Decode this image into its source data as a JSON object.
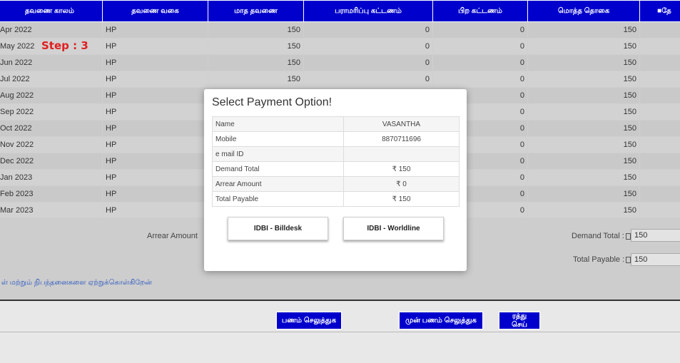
{
  "columns": [
    "தவணை காலம்",
    "தவணை வகை",
    "மாத தவணை",
    "பராமரிப்பு கட்டணம்",
    "பிற கட்டணம்",
    "மொத்த தொகை",
    "■தே"
  ],
  "rows": [
    [
      "Apr 2022",
      "HP",
      "150",
      "0",
      "0",
      "150"
    ],
    [
      "May 2022",
      "HP",
      "150",
      "0",
      "0",
      "150"
    ],
    [
      "Jun 2022",
      "HP",
      "150",
      "0",
      "0",
      "150"
    ],
    [
      "Jul 2022",
      "HP",
      "150",
      "0",
      "0",
      "150"
    ],
    [
      "Aug 2022",
      "HP",
      "",
      "",
      "0",
      "150"
    ],
    [
      "Sep 2022",
      "HP",
      "",
      "",
      "0",
      "150"
    ],
    [
      "Oct 2022",
      "HP",
      "",
      "",
      "0",
      "150"
    ],
    [
      "Nov 2022",
      "HP",
      "",
      "",
      "0",
      "150"
    ],
    [
      "Dec 2022",
      "HP",
      "",
      "",
      "0",
      "150"
    ],
    [
      "Jan 2023",
      "HP",
      "",
      "",
      "0",
      "150"
    ],
    [
      "Feb 2023",
      "HP",
      "",
      "",
      "0",
      "150"
    ],
    [
      "Mar 2023",
      "HP",
      "",
      "",
      "0",
      "150"
    ]
  ],
  "step_label": "Step : 3",
  "summary": {
    "arrear_label": "Arrear Amount",
    "demand_label": "Demand Total :",
    "demand_value": "150",
    "payable_label": "Total Payable :",
    "payable_value": "150"
  },
  "terms_text": "ள் மற்றும் நிபந்தனைகளை ஏற்றுக்கொள்கிறேன்",
  "buttons": {
    "pay": "பணம் செலுத்துக",
    "advance_pay": "முன் பணம் செலுத்துக",
    "cancel": "ரத்து செய்"
  },
  "modal": {
    "title": "Select Payment Option!",
    "fields": [
      {
        "label": "Name",
        "value": "VASANTHA"
      },
      {
        "label": "Mobile",
        "value": "8870711696"
      },
      {
        "label": "e mail ID",
        "value": ""
      },
      {
        "label": "Demand Total",
        "value": "₹ 150"
      },
      {
        "label": "Arrear Amount",
        "value": "₹ 0"
      },
      {
        "label": "Total Payable",
        "value": "₹ 150"
      }
    ],
    "billdesk": "IDBI - Billdesk",
    "worldline": "IDBI - Worldline"
  }
}
